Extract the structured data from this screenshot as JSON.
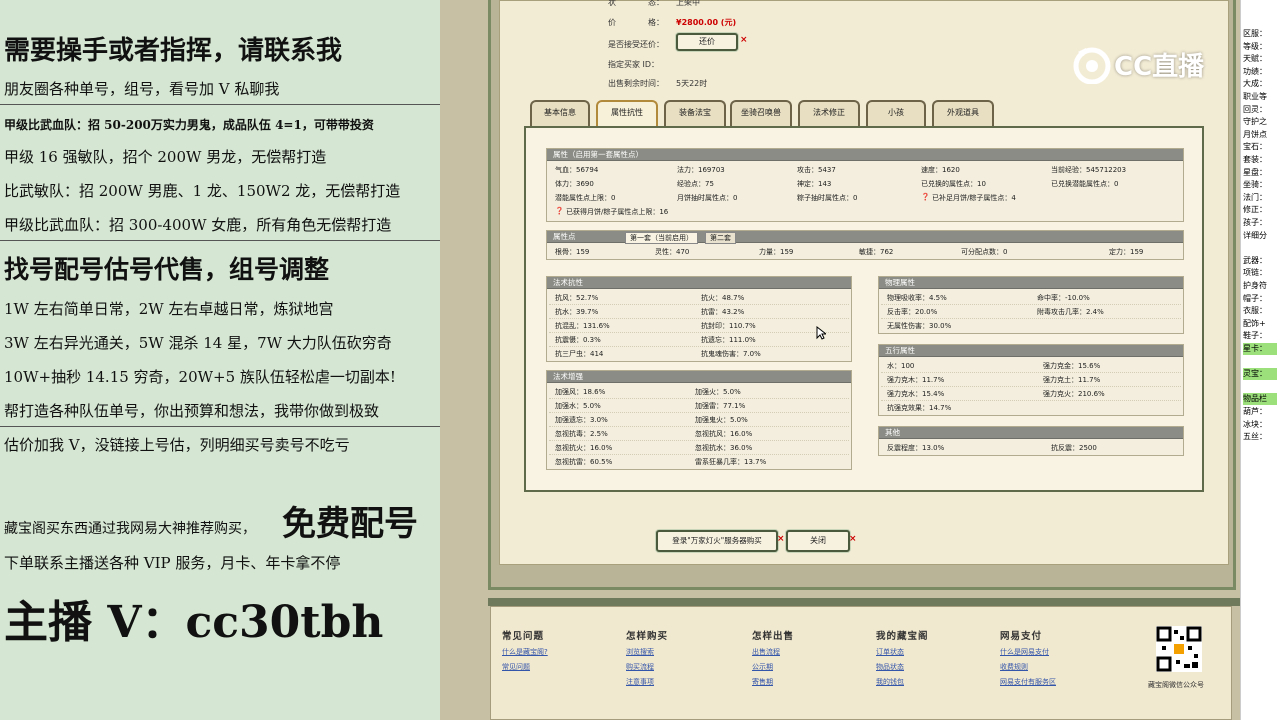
{
  "left_ad": {
    "lines": [
      "需要操手或者指挥，请联系我",
      "朋友圈各种单号，组号，看号加 V 私聊我",
      "甲级比武血队：招 50-200万实力男鬼，成品队伍 4=1，可带带投资",
      "甲级 16 强敏队，招个 200W 男龙，无偿帮打造",
      "比武敏队：招 200W 男鹿、1 龙、150W2 龙，无偿帮打造",
      "甲级比武血队：招 300-400W 女鹿，所有角色无偿帮打造",
      "找号配号估号代售，组号调整",
      "1W 左右简单日常，2W 左右卓越日常，炼狱地宫",
      "3W 左右异光通关，5W 混杀 14 星，7W 大力队伍砍穷奇",
      "10W+抽秒 14.15 穷奇，20W+5 族队伍轻松虐一切副本!",
      "帮打造各种队伍单号，你出预算和想法，我带你做到极致",
      "估价加我 V，没链接上号估，列明细买号卖号不吃亏",
      "藏宝阁买东西通过我网易大神推荐购买，",
      "免费配号",
      "下单联系主播送各种 VIP 服务，月卡、年卡拿不停",
      "主播 V：cc30tbh"
    ]
  },
  "watermark": "CC直播",
  "top_info": {
    "status_label": "状",
    "status_sub": "态：",
    "status_value": "上架中",
    "price_label": "价",
    "price_sub": "格：",
    "price_value": "¥2800.00 (元)",
    "bargain_label": "是否接受还价：",
    "bargain_button": "还价",
    "buyer_label": "指定买家 ID：",
    "time_label": "出售剩余时间：",
    "time_value": "5天22时"
  },
  "tabs": [
    "基本信息",
    "属性抗性",
    "装备法宝",
    "坐骑召唤兽",
    "法术修正",
    "小孩",
    "外观道具"
  ],
  "attributes": {
    "title": "属性（启用第一套属性点）",
    "rows": [
      [
        "气血：56794",
        "法力：169703",
        "攻击：5437",
        "速度：1620",
        "当前经验：545712203"
      ],
      [
        "体力：3690",
        "经验点：75",
        "神定：143",
        "已兑换的属性点：10",
        "已兑换潜能属性点：0"
      ],
      [
        "潜能属性点上限：0",
        "月饼抽时属性点：0",
        "粽子抽时属性点：0",
        "已补足月饼/粽子属性点：4",
        ""
      ]
    ],
    "note": "已获得月饼/粽子属性点上限：16"
  },
  "points": {
    "title": "属性点",
    "tab1": "第一套（当前启用）",
    "tab2": "第二套",
    "values": [
      "根骨：159",
      "灵性：470",
      "力量：159",
      "敏捷：762",
      "可分配点数：0",
      "定力：159"
    ]
  },
  "spell_resist": {
    "title": "法术抗性",
    "rows": [
      [
        "抗风：52.7%",
        "抗火：48.7%"
      ],
      [
        "抗水：39.7%",
        "抗雷：43.2%"
      ],
      [
        "抗混乱：131.6%",
        "抗封印：110.7%"
      ],
      [
        "抗震慑：0.3%",
        "抗遗忘：111.0%"
      ],
      [
        "抗三尸虫：414",
        "抗鬼魂伤害：7.0%"
      ]
    ]
  },
  "spell_boost": {
    "title": "法术增强",
    "rows": [
      [
        "加强风：18.6%",
        "加强火：5.0%"
      ],
      [
        "加强水：5.0%",
        "加强雷：77.1%"
      ],
      [
        "加强遗忘：3.0%",
        "加强鬼火：5.0%"
      ],
      [
        "忽视抗毒：2.5%",
        "忽视抗风：16.0%"
      ],
      [
        "忽视抗火：16.0%",
        "忽视抗水：36.0%"
      ],
      [
        "忽视抗雷：60.5%",
        "雷系狂暴几率：13.7%"
      ]
    ]
  },
  "physical": {
    "title": "物理属性",
    "rows": [
      [
        "物理吸收率：4.5%",
        "命中率：-10.0%"
      ],
      [
        "反击率：20.0%",
        "附毒攻击几率：2.4%"
      ],
      [
        "无属性伤害：30.0%",
        ""
      ]
    ]
  },
  "five_elements": {
    "title": "五行属性",
    "rows": [
      [
        "水：100",
        "强力克金：15.6%"
      ],
      [
        "强力克木：11.7%",
        "强力克土：11.7%"
      ],
      [
        "强力克水：15.4%",
        "强力克火：210.6%"
      ],
      [
        "抗强克效果：14.7%",
        ""
      ]
    ]
  },
  "other": {
    "title": "其他",
    "rows": [
      [
        "反震程度：13.0%",
        "抗反震：2500"
      ]
    ]
  },
  "bottom_buttons": {
    "login": "登录\"万家灯火\"服务器购买",
    "close": "关闭"
  },
  "footer": {
    "columns": [
      {
        "title": "常见问题",
        "links": [
          "什么是藏宝阁?",
          "常见问题"
        ]
      },
      {
        "title": "怎样购买",
        "links": [
          "浏览搜索",
          "购买流程",
          "注意事项"
        ]
      },
      {
        "title": "怎样出售",
        "links": [
          "出售流程",
          "公示期",
          "寄售期"
        ]
      },
      {
        "title": "我的藏宝阁",
        "links": [
          "订单状态",
          "物品状态",
          "我的钱包"
        ]
      },
      {
        "title": "网易支付",
        "links": [
          "什么是网易支付",
          "收费规则",
          "网易支付有服务区"
        ]
      }
    ],
    "qr_caption": "藏宝阁微信公众号"
  },
  "right_panel": {
    "labels": [
      "区服：",
      "等级：",
      "天赋：",
      "功绩：",
      "大成：",
      "职业等",
      "回灵：",
      "守护之",
      "月饼点",
      "宝石：",
      "套装：",
      "星盘：",
      "坐骑：",
      "法门：",
      "修正：",
      "孩子：",
      "详细分",
      "",
      "武器：",
      "项链：",
      "护身符",
      "帽子：",
      "衣服：",
      "配饰+",
      "鞋子：",
      "星卡：",
      "",
      "灵宝：",
      "",
      "物品栏",
      "葫芦：",
      "冰块：",
      "五丝："
    ],
    "highlight": [
      25,
      27,
      29
    ]
  }
}
